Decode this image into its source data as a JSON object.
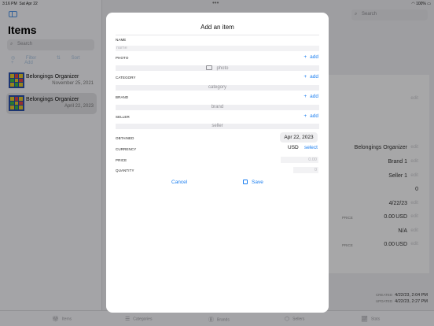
{
  "status_bar": {
    "time": "3:16 PM",
    "date": "Sat Apr 22",
    "battery": "100%"
  },
  "sidebar": {
    "title": "Items",
    "search_placeholder": "Search",
    "filter_label": "Filter",
    "sort_label": "Sort",
    "add_label": "Add",
    "items": [
      {
        "title": "Belongings Organizer",
        "date": "November 25, 2021"
      },
      {
        "title": "Belongings Organizer",
        "date": "April 22, 2023"
      }
    ]
  },
  "detail": {
    "search_placeholder": "Search",
    "edit_label": "edit",
    "app_name": "Belongings Organizer",
    "brand": "Brand 1",
    "seller": "Seller 1",
    "quantity": "0",
    "date": "4/22/23",
    "price_label": "PRICE",
    "price_value": "0.00",
    "currency": "USD",
    "na": "N/A",
    "price2_value": "0.00",
    "created_label": "CREATED",
    "created_value": "4/22/23, 2:04 PM",
    "updated_label": "UPDATED",
    "updated_value": "4/22/23, 2:27 PM"
  },
  "tabbar": {
    "tabs": [
      {
        "label": "Items",
        "icon": "gift-icon"
      },
      {
        "label": "Categories",
        "icon": "list-icon"
      },
      {
        "label": "Brands",
        "icon": "b-circle-icon"
      },
      {
        "label": "Sellers",
        "icon": "boxes-icon"
      },
      {
        "label": "Stats",
        "icon": "chart-icon"
      }
    ]
  },
  "modal": {
    "title": "Add an item",
    "name_label": "NAME",
    "name_placeholder": "name",
    "photo_label": "PHOTO",
    "photo_placeholder": "photo",
    "category_label": "CATEGORY",
    "category_placeholder": "category",
    "brand_label": "BRAND",
    "brand_placeholder": "brand",
    "seller_label": "SELLER",
    "seller_placeholder": "seller",
    "add_label": "add",
    "obtained_label": "OBTAINED",
    "obtained_value": "Apr 22, 2023",
    "currency_label": "CURRENCY",
    "currency_value": "USD",
    "select_label": "select",
    "price_label": "PRICE",
    "price_placeholder": "0.00",
    "quantity_label": "QUANTITY",
    "quantity_placeholder": "0",
    "cancel_label": "Cancel",
    "save_label": "Save"
  },
  "colors": {
    "accent": "#1a7ef0",
    "dim_overlay": "rgba(0,0,0,0.32)"
  }
}
